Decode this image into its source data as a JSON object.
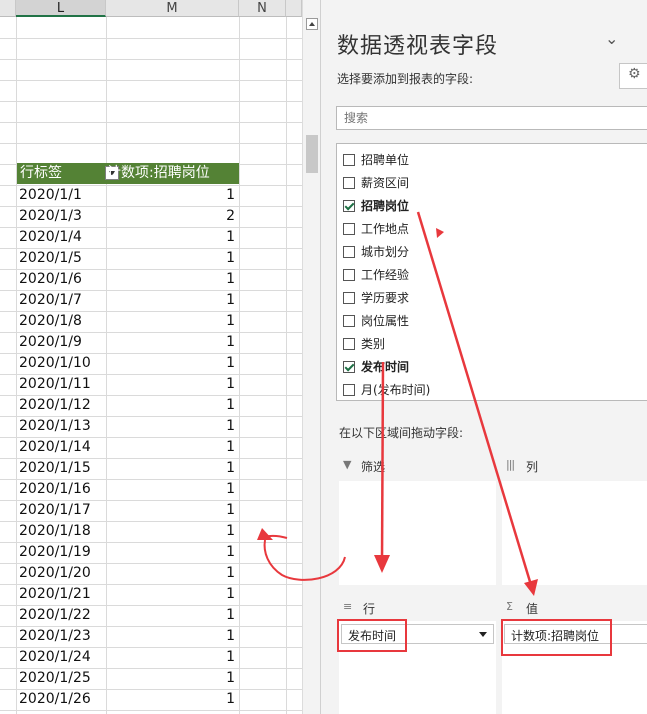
{
  "sheet": {
    "columns": [
      "L",
      "M",
      "N"
    ],
    "pivot": {
      "row_label_header": "行标签",
      "value_header": "计数项:招聘岗位",
      "rows": [
        {
          "date": "2020/1/1",
          "count": "1"
        },
        {
          "date": "2020/1/3",
          "count": "2"
        },
        {
          "date": "2020/1/4",
          "count": "1"
        },
        {
          "date": "2020/1/5",
          "count": "1"
        },
        {
          "date": "2020/1/6",
          "count": "1"
        },
        {
          "date": "2020/1/7",
          "count": "1"
        },
        {
          "date": "2020/1/8",
          "count": "1"
        },
        {
          "date": "2020/1/9",
          "count": "1"
        },
        {
          "date": "2020/1/10",
          "count": "1"
        },
        {
          "date": "2020/1/11",
          "count": "1"
        },
        {
          "date": "2020/1/12",
          "count": "1"
        },
        {
          "date": "2020/1/13",
          "count": "1"
        },
        {
          "date": "2020/1/14",
          "count": "1"
        },
        {
          "date": "2020/1/15",
          "count": "1"
        },
        {
          "date": "2020/1/16",
          "count": "1"
        },
        {
          "date": "2020/1/17",
          "count": "1"
        },
        {
          "date": "2020/1/18",
          "count": "1"
        },
        {
          "date": "2020/1/19",
          "count": "1"
        },
        {
          "date": "2020/1/20",
          "count": "1"
        },
        {
          "date": "2020/1/21",
          "count": "1"
        },
        {
          "date": "2020/1/22",
          "count": "1"
        },
        {
          "date": "2020/1/23",
          "count": "1"
        },
        {
          "date": "2020/1/24",
          "count": "1"
        },
        {
          "date": "2020/1/25",
          "count": "1"
        },
        {
          "date": "2020/1/26",
          "count": "1"
        }
      ]
    }
  },
  "pane": {
    "title": "数据透视表字段",
    "subtitle": "选择要添加到报表的字段:",
    "search_placeholder": "搜索",
    "fields": [
      {
        "name": "招聘单位",
        "checked": false
      },
      {
        "name": "薪资区间",
        "checked": false
      },
      {
        "name": "招聘岗位",
        "checked": true
      },
      {
        "name": "工作地点",
        "checked": false
      },
      {
        "name": "城市划分",
        "checked": false
      },
      {
        "name": "工作经验",
        "checked": false
      },
      {
        "name": "学历要求",
        "checked": false
      },
      {
        "name": "岗位属性",
        "checked": false
      },
      {
        "name": "类别",
        "checked": false
      },
      {
        "name": "发布时间",
        "checked": true
      },
      {
        "name": "月(发布时间)",
        "checked": false
      }
    ],
    "drag_label": "在以下区域间拖动字段:",
    "areas": {
      "filter": {
        "title": "筛选"
      },
      "columns": {
        "title": "列"
      },
      "rows": {
        "title": "行",
        "chip": "发布时间"
      },
      "values": {
        "title": "值",
        "chip": "计数项:招聘岗位"
      }
    }
  },
  "annotation_color": "#e8383d",
  "accent_color": "#548235"
}
